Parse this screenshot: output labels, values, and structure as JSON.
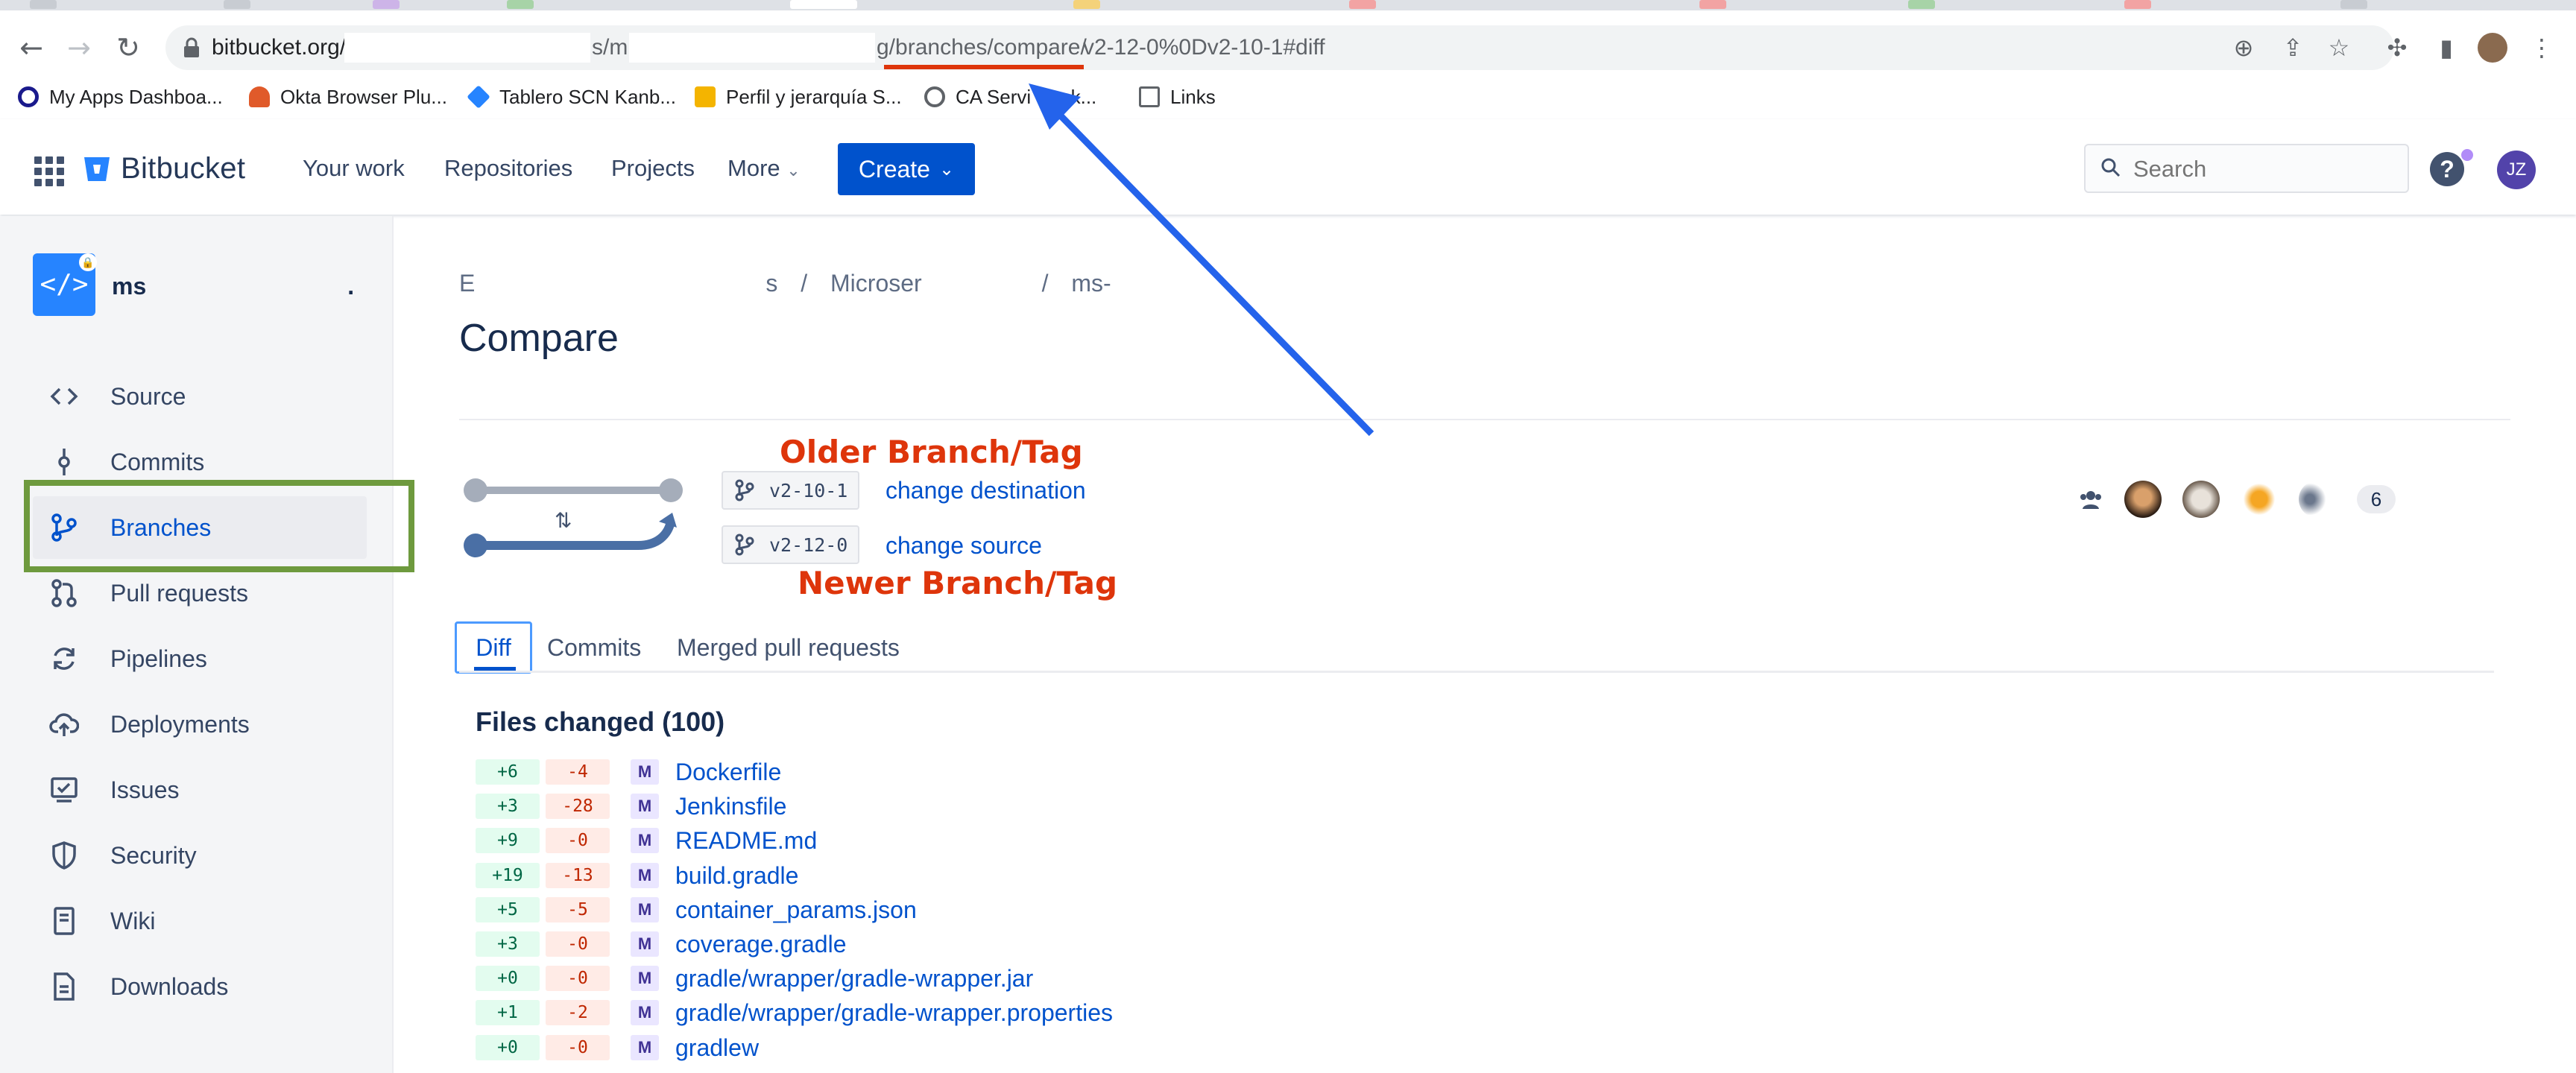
{
  "browser": {
    "url_prefix": "bitbucket.org/b",
    "url_mid": "s/m",
    "url_path": "g/branches/compare/",
    "url_suffix": "v2-12-0%0Dv2-10-1#diff",
    "bookmarks": [
      {
        "label": "My Apps Dashboa...",
        "icon": "okta-icon",
        "color": "#1a1a8c"
      },
      {
        "label": "Okta Browser Plu...",
        "icon": "okta-plugin-icon",
        "color": "#e05a2a"
      },
      {
        "label": "Tablero SCN Kanb...",
        "icon": "jira-icon",
        "color": "#2684ff"
      },
      {
        "label": "Perfil y jerarquía S...",
        "icon": "slides-icon",
        "color": "#f4b400"
      },
      {
        "label": "CA Servi   Desk...",
        "icon": "globe-icon",
        "color": "#5f6368"
      },
      {
        "label": "Links",
        "icon": "folder-icon",
        "color": "#5f6368"
      }
    ]
  },
  "header": {
    "logo": "Bitbucket",
    "nav": [
      "Your work",
      "Repositories",
      "Projects",
      "More"
    ],
    "create_label": "Create",
    "search_placeholder": "Search",
    "avatar_initials": "JZ"
  },
  "sidebar": {
    "repo_name": "ms",
    "repo_suffix": ".",
    "items": [
      {
        "label": "Source",
        "icon": "code-icon"
      },
      {
        "label": "Commits",
        "icon": "commit-icon"
      },
      {
        "label": "Branches",
        "icon": "branch-icon",
        "active": true
      },
      {
        "label": "Pull requests",
        "icon": "pull-request-icon"
      },
      {
        "label": "Pipelines",
        "icon": "pipelines-icon"
      },
      {
        "label": "Deployments",
        "icon": "cloud-upload-icon"
      },
      {
        "label": "Issues",
        "icon": "issues-icon"
      },
      {
        "label": "Security",
        "icon": "shield-icon"
      },
      {
        "label": "Wiki",
        "icon": "wiki-icon"
      },
      {
        "label": "Downloads",
        "icon": "file-icon"
      }
    ]
  },
  "main": {
    "breadcrumb": [
      "E",
      "s",
      "/",
      "Microser",
      "/",
      "ms-"
    ],
    "title": "Compare",
    "destination_branch": "v2-10-1",
    "source_branch": "v2-12-0",
    "change_destination": "change destination",
    "change_source": "change source",
    "annotation_older": "Older Branch/Tag",
    "annotation_newer": "Newer Branch/Tag",
    "participant_count": "6",
    "tabs": [
      "Diff",
      "Commits",
      "Merged pull requests"
    ],
    "files_heading": "Files changed (100)",
    "files": [
      {
        "add": "+6",
        "del": "-4",
        "status": "M",
        "name": "Dockerfile"
      },
      {
        "add": "+3",
        "del": "-28",
        "status": "M",
        "name": "Jenkinsfile"
      },
      {
        "add": "+9",
        "del": "-0",
        "status": "M",
        "name": "README.md"
      },
      {
        "add": "+19",
        "del": "-13",
        "status": "M",
        "name": "build.gradle"
      },
      {
        "add": "+5",
        "del": "-5",
        "status": "M",
        "name": "container_params.json"
      },
      {
        "add": "+3",
        "del": "-0",
        "status": "M",
        "name": "coverage.gradle"
      },
      {
        "add": "+0",
        "del": "-0",
        "status": "M",
        "name": "gradle/wrapper/gradle-wrapper.jar"
      },
      {
        "add": "+1",
        "del": "-2",
        "status": "M",
        "name": "gradle/wrapper/gradle-wrapper.properties"
      },
      {
        "add": "+0",
        "del": "-0",
        "status": "M",
        "name": "gradlew"
      }
    ]
  },
  "colors": {
    "brand": "#0052cc",
    "annotation_red": "#de350b",
    "arrow_blue": "#2463eb",
    "highlight_green": "#6e9a3e"
  }
}
